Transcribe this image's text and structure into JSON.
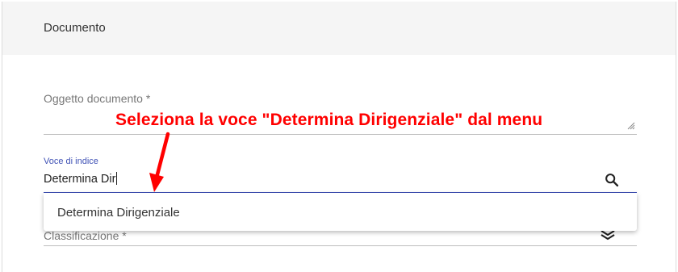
{
  "section": {
    "title": "Documento"
  },
  "oggetto_field": {
    "label": "Oggetto documento *",
    "value": ""
  },
  "voce_field": {
    "label": "Voce di indice",
    "value": "Determina Dir",
    "search_icon": "search-icon"
  },
  "autocomplete": {
    "options": [
      "Determina Dirigenziale"
    ]
  },
  "classificazione_field": {
    "label": "Classificazione *",
    "icon": "layers-icon"
  },
  "annotation": {
    "text": "Seleziona la voce \"Determina Dirigenziale\" dal menu",
    "color": "#ff0000"
  },
  "colors": {
    "accent": "#3f51b5",
    "header_bg": "#f5f5f5"
  }
}
